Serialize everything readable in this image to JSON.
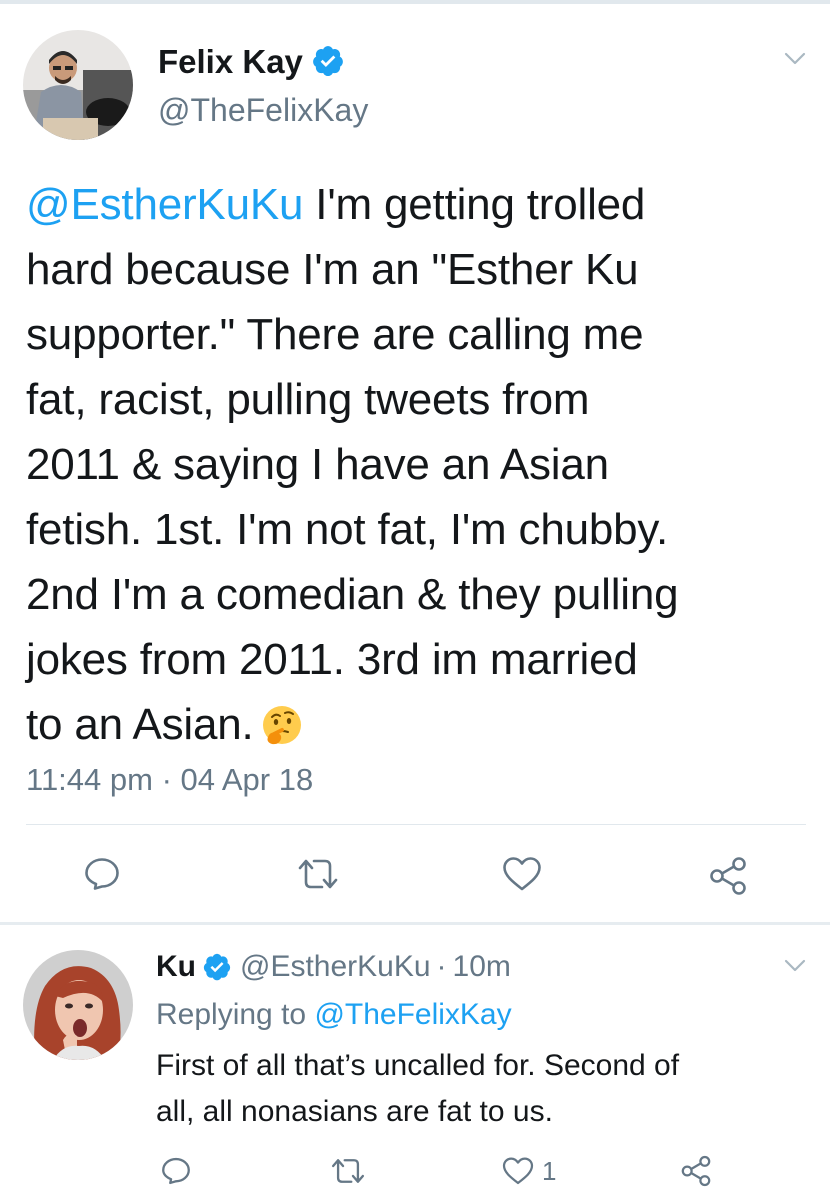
{
  "main_tweet": {
    "author_name": "Felix Kay",
    "author_handle": "@TheFelixKay",
    "verified": true,
    "text_lines": [
      {
        "mention": "@EstherKuKu",
        "text": " I'm getting trolled"
      },
      {
        "mention": "",
        "text": "hard because I'm an \"Esther Ku"
      },
      {
        "mention": "",
        "text": "supporter.\" There are calling me"
      },
      {
        "mention": "",
        "text": "fat, racist, pulling tweets from"
      },
      {
        "mention": "",
        "text": "2011 & saying I have an Asian"
      },
      {
        "mention": "",
        "text": "fetish. 1st. I'm not fat, I'm chubby."
      },
      {
        "mention": "",
        "text": "2nd I'm a comedian & they pulling"
      },
      {
        "mention": "",
        "text": "jokes from 2011. 3rd im married"
      },
      {
        "mention": "",
        "text": "to an Asian."
      }
    ],
    "emoji": "thinking-face-icon",
    "timestamp": "11:44 pm · 04 Apr 18",
    "actions": [
      "reply-icon",
      "retweet-icon",
      "like-icon",
      "share-icon"
    ]
  },
  "reply_tweet": {
    "author_name": "Ku",
    "verified": true,
    "author_handle": "@EstherKuKu",
    "separator": "·",
    "time_ago": "10m",
    "replying_prefix": "Replying to ",
    "replying_to": "@TheFelixKay",
    "text_lines": [
      "First of all that’s uncalled for. Second of",
      "all, all nonasians are fat to us."
    ],
    "like_count": "1",
    "actions": [
      "reply-icon",
      "retweet-icon",
      "like-icon",
      "share-icon"
    ]
  },
  "colors": {
    "accent": "#1da1f2",
    "secondary_text": "#657786",
    "primary_text": "#14171a",
    "icon": "#657786",
    "divider": "#e1e8ed"
  }
}
